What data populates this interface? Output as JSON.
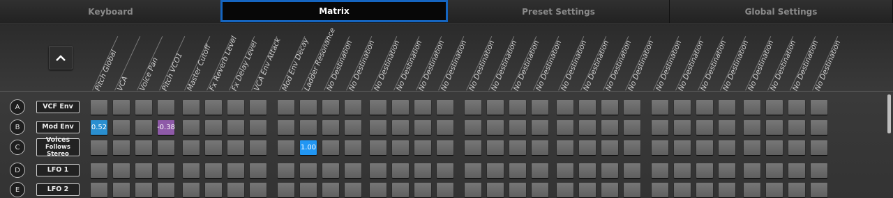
{
  "tabs": [
    {
      "label": "Keyboard",
      "active": false
    },
    {
      "label": "Matrix",
      "active": true
    },
    {
      "label": "Preset Settings",
      "active": false
    },
    {
      "label": "Global Settings",
      "active": false
    }
  ],
  "collapse_icon": "chevron-up-icon",
  "destinations": [
    "Pitch Global",
    "VCA",
    "Voice Pan",
    "Pitch VCO1",
    "Master Cutoff",
    "Fx Reverb Level",
    "Fx Delay Level",
    "VCA Env Attack",
    "Mod Env Decay",
    "Ladder Resonance",
    "No Destination",
    "No Destination",
    "No Destination",
    "No Destination",
    "No Destination",
    "No Destination",
    "No Destination",
    "No Destination",
    "No Destination",
    "No Destination",
    "No Destination",
    "No Destination",
    "No Destination",
    "No Destination",
    "No Destination",
    "No Destination",
    "No Destination",
    "No Destination",
    "No Destination",
    "No Destination",
    "No Destination",
    "No Destination"
  ],
  "rows": [
    {
      "letter": "A",
      "label": "VCF Env",
      "sub": ""
    },
    {
      "letter": "B",
      "label": "Mod Env",
      "sub": ""
    },
    {
      "letter": "C",
      "label": "Voices",
      "sub": "Follows Stereo"
    },
    {
      "letter": "D",
      "label": "LFO 1",
      "sub": ""
    },
    {
      "letter": "E",
      "label": "LFO 2",
      "sub": ""
    }
  ],
  "cells": [
    {
      "row": 1,
      "col": 0,
      "value": "0.52",
      "color": "#2a8fd0"
    },
    {
      "row": 1,
      "col": 3,
      "value": "-0.38",
      "color": "#8e5aa8"
    },
    {
      "row": 2,
      "col": 9,
      "value": "1.00",
      "color": "#2196f3"
    }
  ],
  "colors": {
    "accent": "#1565c0",
    "blue": "#2a8fd0",
    "purple": "#8e5aa8"
  }
}
